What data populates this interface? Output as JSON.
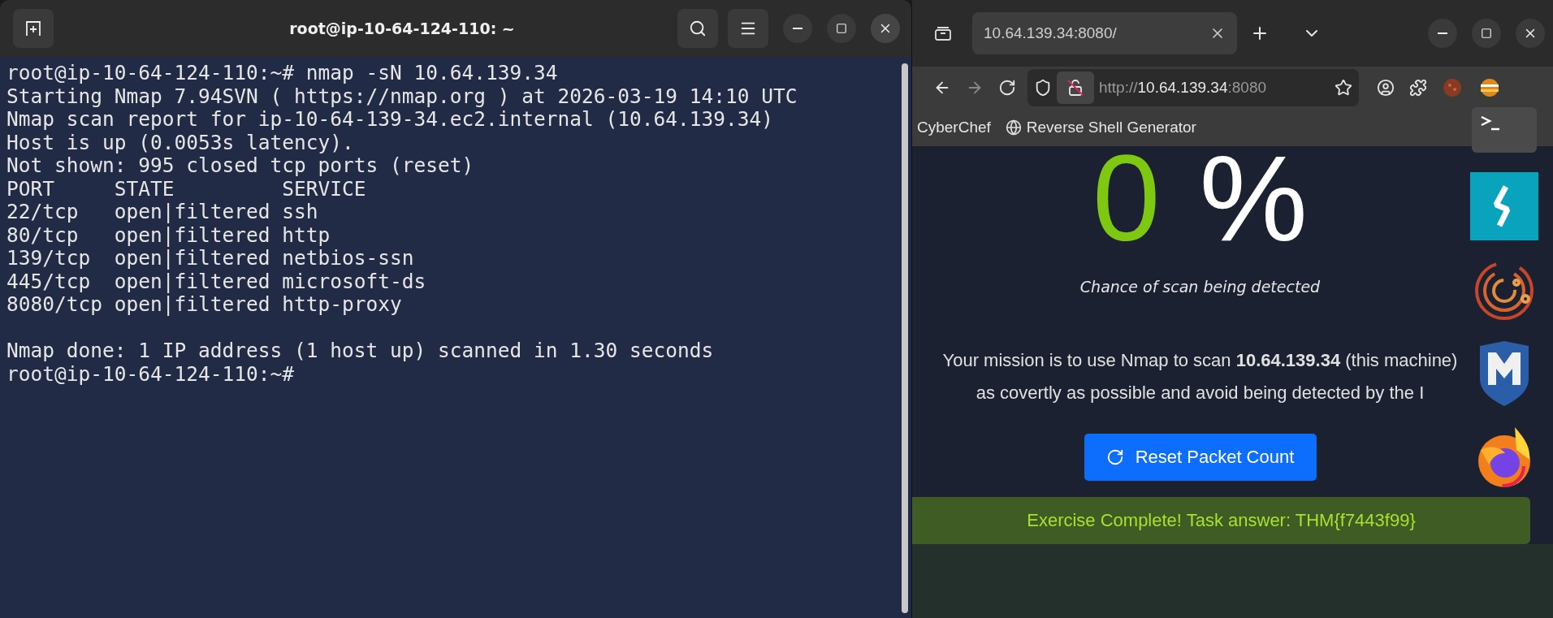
{
  "terminal": {
    "title": "root@ip-10-64-124-110: ~",
    "blocks": [
      [
        "root@ip-10-64-124-110:~# nmap -sN 10.64.139.34",
        "Starting Nmap 7.94SVN ( https://nmap.org ) at 2026-03-19 14:10 UTC",
        "Nmap scan report for ip-10-64-139-34.ec2.internal (10.64.139.34)",
        "Host is up (0.0053s latency).",
        "Not shown: 995 closed tcp ports (reset)",
        "PORT     STATE         SERVICE",
        "22/tcp   open|filtered ssh",
        "80/tcp   open|filtered http",
        "139/tcp  open|filtered netbios-ssn",
        "445/tcp  open|filtered microsoft-ds",
        "8080/tcp open|filtered http-proxy"
      ],
      [
        "Nmap done: 1 IP address (1 host up) scanned in 1.30 seconds",
        "root@ip-10-64-124-110:~#"
      ]
    ]
  },
  "browser": {
    "tabs": [
      {
        "title": "10.64.139.34:8080/",
        "selected": true
      }
    ],
    "url": {
      "scheme": "http://",
      "host": "10.64.139.34",
      "port": ":8080"
    },
    "bookmarks": [
      {
        "label": "CyberChef"
      },
      {
        "label": "Reverse Shell Generator"
      }
    ],
    "page": {
      "percent_value": "0",
      "percent_sign": "%",
      "caption": "Chance of scan being detected",
      "mission": "Your mission is to use Nmap to scan **10.64.139.34** (this machine)\nas covertly as possible and avoid being detected by the I",
      "button": "Reset Packet Count",
      "alert": "Exercise Complete! Task answer: THM{f7443f99}"
    }
  }
}
